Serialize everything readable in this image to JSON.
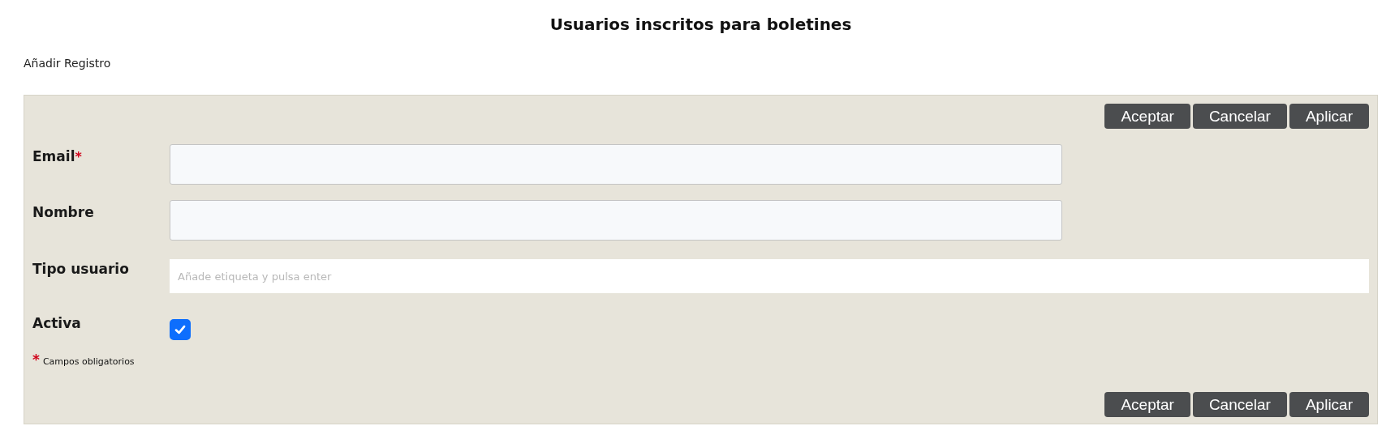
{
  "title": "Usuarios inscritos para boletines",
  "subtitle": "Añadir Registro",
  "top_buttons": [
    "Aceptar",
    "Cancelar",
    "Aplicar"
  ],
  "fields": [
    {
      "kind": "text",
      "label": "Email",
      "required_mark": "*"
    },
    {
      "kind": "text",
      "label": "Nombre"
    },
    {
      "kind": "tags",
      "label": "Tipo usuario",
      "placeholder": "Añade etiqueta y pulsa enter"
    },
    {
      "kind": "checkbox",
      "label": "Activa",
      "checked": true
    }
  ],
  "footnote": {
    "mark": "*",
    "text": "Campos obligatorios"
  },
  "bottom_buttons": [
    "Aceptar",
    "Cancelar",
    "Aplicar"
  ]
}
